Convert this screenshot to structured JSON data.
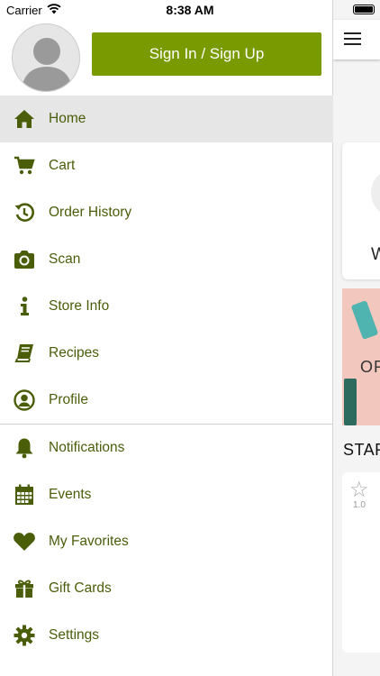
{
  "status_bar": {
    "carrier": "Carrier",
    "time": "8:38 AM"
  },
  "colors": {
    "accent": "#7a9a01",
    "menu_text": "#4a5e0a",
    "active_row": "#e6e6e6"
  },
  "header": {
    "sign_in_label": "Sign In / Sign Up"
  },
  "menu_primary": [
    {
      "label": "Home",
      "icon": "home-icon",
      "active": true
    },
    {
      "label": "Cart",
      "icon": "cart-icon"
    },
    {
      "label": "Order History",
      "icon": "history-icon"
    },
    {
      "label": "Scan",
      "icon": "camera-icon"
    },
    {
      "label": "Store Info",
      "icon": "info-icon"
    },
    {
      "label": "Recipes",
      "icon": "book-icon"
    },
    {
      "label": "Profile",
      "icon": "user-circle-icon"
    }
  ],
  "menu_secondary": [
    {
      "label": "Notifications",
      "icon": "bell-icon"
    },
    {
      "label": "Events",
      "icon": "calendar-icon"
    },
    {
      "label": "My Favorites",
      "icon": "heart-icon"
    },
    {
      "label": "Gift Cards",
      "icon": "gift-icon"
    },
    {
      "label": "Settings",
      "icon": "gear-icon"
    }
  ],
  "background_page": {
    "card_letter": "W",
    "banner_word": "OR",
    "section_label": "STAR",
    "rating": "1.0"
  }
}
